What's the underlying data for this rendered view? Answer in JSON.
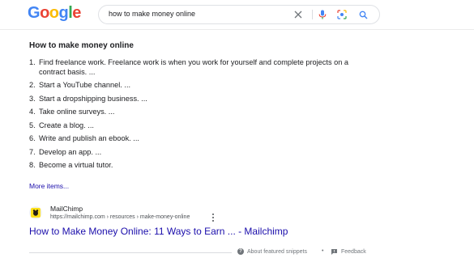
{
  "header": {
    "logo": [
      "G",
      "o",
      "o",
      "g",
      "l",
      "e"
    ],
    "logo_colors": [
      "#4285F4",
      "#EA4335",
      "#FBBC05",
      "#4285F4",
      "#34A853",
      "#EA4335"
    ],
    "query": "how to make money online",
    "icons": [
      "close-icon",
      "mic-icon",
      "lens-icon",
      "search-icon"
    ]
  },
  "snippet": {
    "title": "How to make money online",
    "items": [
      {
        "num": "1.",
        "text": "Find freelance work. Freelance work is when you work for yourself and complete projects on a contract basis. ..."
      },
      {
        "num": "2.",
        "text": "Start a YouTube channel. ..."
      },
      {
        "num": "3.",
        "text": "Start a dropshipping business. ..."
      },
      {
        "num": "4.",
        "text": "Take online surveys. ..."
      },
      {
        "num": "5.",
        "text": "Create a blog. ..."
      },
      {
        "num": "6.",
        "text": "Write and publish an ebook. ..."
      },
      {
        "num": "7.",
        "text": "Develop an app. ..."
      },
      {
        "num": "8.",
        "text": "Become a virtual tutor."
      }
    ],
    "more_link": "More items..."
  },
  "result": {
    "site_name": "MailChimp",
    "url": "https://mailchimp.com › resources › make-money-online",
    "title": "How to Make Money Online: 11 Ways to Earn ... - Mailchimp",
    "favicon_color": "#FFE01B"
  },
  "footer": {
    "about": "About featured snippets",
    "separator": "•",
    "feedback": "Feedback"
  },
  "colors": {
    "link": "#1a0dab",
    "text": "#202124",
    "muted": "#70757a"
  }
}
